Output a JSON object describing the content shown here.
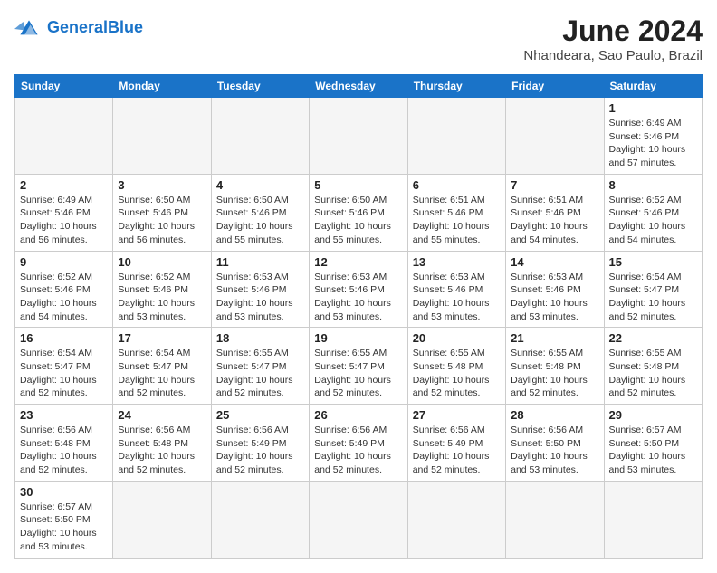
{
  "header": {
    "logo_general": "General",
    "logo_blue": "Blue",
    "month_title": "June 2024",
    "subtitle": "Nhandeara, Sao Paulo, Brazil"
  },
  "days_of_week": [
    "Sunday",
    "Monday",
    "Tuesday",
    "Wednesday",
    "Thursday",
    "Friday",
    "Saturday"
  ],
  "weeks": [
    [
      {
        "day": "",
        "info": ""
      },
      {
        "day": "",
        "info": ""
      },
      {
        "day": "",
        "info": ""
      },
      {
        "day": "",
        "info": ""
      },
      {
        "day": "",
        "info": ""
      },
      {
        "day": "",
        "info": ""
      },
      {
        "day": "1",
        "info": "Sunrise: 6:49 AM\nSunset: 5:46 PM\nDaylight: 10 hours\nand 57 minutes."
      }
    ],
    [
      {
        "day": "2",
        "info": "Sunrise: 6:49 AM\nSunset: 5:46 PM\nDaylight: 10 hours\nand 56 minutes."
      },
      {
        "day": "3",
        "info": "Sunrise: 6:50 AM\nSunset: 5:46 PM\nDaylight: 10 hours\nand 56 minutes."
      },
      {
        "day": "4",
        "info": "Sunrise: 6:50 AM\nSunset: 5:46 PM\nDaylight: 10 hours\nand 55 minutes."
      },
      {
        "day": "5",
        "info": "Sunrise: 6:50 AM\nSunset: 5:46 PM\nDaylight: 10 hours\nand 55 minutes."
      },
      {
        "day": "6",
        "info": "Sunrise: 6:51 AM\nSunset: 5:46 PM\nDaylight: 10 hours\nand 55 minutes."
      },
      {
        "day": "7",
        "info": "Sunrise: 6:51 AM\nSunset: 5:46 PM\nDaylight: 10 hours\nand 54 minutes."
      },
      {
        "day": "8",
        "info": "Sunrise: 6:52 AM\nSunset: 5:46 PM\nDaylight: 10 hours\nand 54 minutes."
      }
    ],
    [
      {
        "day": "9",
        "info": "Sunrise: 6:52 AM\nSunset: 5:46 PM\nDaylight: 10 hours\nand 54 minutes."
      },
      {
        "day": "10",
        "info": "Sunrise: 6:52 AM\nSunset: 5:46 PM\nDaylight: 10 hours\nand 53 minutes."
      },
      {
        "day": "11",
        "info": "Sunrise: 6:53 AM\nSunset: 5:46 PM\nDaylight: 10 hours\nand 53 minutes."
      },
      {
        "day": "12",
        "info": "Sunrise: 6:53 AM\nSunset: 5:46 PM\nDaylight: 10 hours\nand 53 minutes."
      },
      {
        "day": "13",
        "info": "Sunrise: 6:53 AM\nSunset: 5:46 PM\nDaylight: 10 hours\nand 53 minutes."
      },
      {
        "day": "14",
        "info": "Sunrise: 6:53 AM\nSunset: 5:46 PM\nDaylight: 10 hours\nand 53 minutes."
      },
      {
        "day": "15",
        "info": "Sunrise: 6:54 AM\nSunset: 5:47 PM\nDaylight: 10 hours\nand 52 minutes."
      }
    ],
    [
      {
        "day": "16",
        "info": "Sunrise: 6:54 AM\nSunset: 5:47 PM\nDaylight: 10 hours\nand 52 minutes."
      },
      {
        "day": "17",
        "info": "Sunrise: 6:54 AM\nSunset: 5:47 PM\nDaylight: 10 hours\nand 52 minutes."
      },
      {
        "day": "18",
        "info": "Sunrise: 6:55 AM\nSunset: 5:47 PM\nDaylight: 10 hours\nand 52 minutes."
      },
      {
        "day": "19",
        "info": "Sunrise: 6:55 AM\nSunset: 5:47 PM\nDaylight: 10 hours\nand 52 minutes."
      },
      {
        "day": "20",
        "info": "Sunrise: 6:55 AM\nSunset: 5:48 PM\nDaylight: 10 hours\nand 52 minutes."
      },
      {
        "day": "21",
        "info": "Sunrise: 6:55 AM\nSunset: 5:48 PM\nDaylight: 10 hours\nand 52 minutes."
      },
      {
        "day": "22",
        "info": "Sunrise: 6:55 AM\nSunset: 5:48 PM\nDaylight: 10 hours\nand 52 minutes."
      }
    ],
    [
      {
        "day": "23",
        "info": "Sunrise: 6:56 AM\nSunset: 5:48 PM\nDaylight: 10 hours\nand 52 minutes."
      },
      {
        "day": "24",
        "info": "Sunrise: 6:56 AM\nSunset: 5:48 PM\nDaylight: 10 hours\nand 52 minutes."
      },
      {
        "day": "25",
        "info": "Sunrise: 6:56 AM\nSunset: 5:49 PM\nDaylight: 10 hours\nand 52 minutes."
      },
      {
        "day": "26",
        "info": "Sunrise: 6:56 AM\nSunset: 5:49 PM\nDaylight: 10 hours\nand 52 minutes."
      },
      {
        "day": "27",
        "info": "Sunrise: 6:56 AM\nSunset: 5:49 PM\nDaylight: 10 hours\nand 52 minutes."
      },
      {
        "day": "28",
        "info": "Sunrise: 6:56 AM\nSunset: 5:50 PM\nDaylight: 10 hours\nand 53 minutes."
      },
      {
        "day": "29",
        "info": "Sunrise: 6:57 AM\nSunset: 5:50 PM\nDaylight: 10 hours\nand 53 minutes."
      }
    ],
    [
      {
        "day": "30",
        "info": "Sunrise: 6:57 AM\nSunset: 5:50 PM\nDaylight: 10 hours\nand 53 minutes."
      },
      {
        "day": "",
        "info": ""
      },
      {
        "day": "",
        "info": ""
      },
      {
        "day": "",
        "info": ""
      },
      {
        "day": "",
        "info": ""
      },
      {
        "day": "",
        "info": ""
      },
      {
        "day": "",
        "info": ""
      }
    ]
  ]
}
